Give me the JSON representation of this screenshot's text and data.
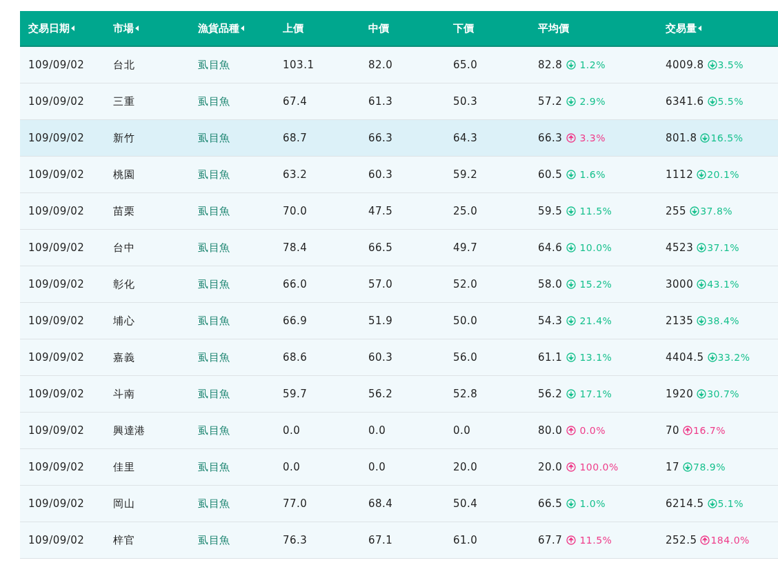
{
  "table": {
    "columns": [
      {
        "label": "交易日期",
        "sortable": true
      },
      {
        "label": "市場",
        "sortable": true
      },
      {
        "label": "漁貨品種",
        "sortable": true
      },
      {
        "label": "上價",
        "sortable": false
      },
      {
        "label": "中價",
        "sortable": false
      },
      {
        "label": "下價",
        "sortable": false
      },
      {
        "label": "平均價",
        "sortable": false
      },
      {
        "label": "交易量",
        "sortable": true
      }
    ],
    "rows": [
      {
        "selected": false,
        "date": "109/09/02",
        "market": "台北",
        "species": "虱目魚",
        "high": "103.1",
        "mid": "82.0",
        "low": "65.0",
        "avg": "82.8",
        "avg_change": {
          "kind": "down",
          "text": "1.2%"
        },
        "volume": "4009.8",
        "volume_change": {
          "kind": "down",
          "text": "3.5%"
        }
      },
      {
        "selected": false,
        "date": "109/09/02",
        "market": "三重",
        "species": "虱目魚",
        "high": "67.4",
        "mid": "61.3",
        "low": "50.3",
        "avg": "57.2",
        "avg_change": {
          "kind": "down",
          "text": "2.9%"
        },
        "volume": "6341.6",
        "volume_change": {
          "kind": "down",
          "text": "5.5%"
        }
      },
      {
        "selected": true,
        "date": "109/09/02",
        "market": "新竹",
        "species": "虱目魚",
        "high": "68.7",
        "mid": "66.3",
        "low": "64.3",
        "avg": "66.3",
        "avg_change": {
          "kind": "up",
          "text": "3.3%"
        },
        "volume": "801.8",
        "volume_change": {
          "kind": "down",
          "text": "16.5%"
        }
      },
      {
        "selected": false,
        "date": "109/09/02",
        "market": "桃園",
        "species": "虱目魚",
        "high": "63.2",
        "mid": "60.3",
        "low": "59.2",
        "avg": "60.5",
        "avg_change": {
          "kind": "down",
          "text": "1.6%"
        },
        "volume": "1112",
        "volume_change": {
          "kind": "down",
          "text": "20.1%"
        }
      },
      {
        "selected": false,
        "date": "109/09/02",
        "market": "苗栗",
        "species": "虱目魚",
        "high": "70.0",
        "mid": "47.5",
        "low": "25.0",
        "avg": "59.5",
        "avg_change": {
          "kind": "down",
          "text": "11.5%"
        },
        "volume": "255",
        "volume_change": {
          "kind": "down",
          "text": "37.8%"
        }
      },
      {
        "selected": false,
        "date": "109/09/02",
        "market": "台中",
        "species": "虱目魚",
        "high": "78.4",
        "mid": "66.5",
        "low": "49.7",
        "avg": "64.6",
        "avg_change": {
          "kind": "down",
          "text": "10.0%"
        },
        "volume": "4523",
        "volume_change": {
          "kind": "down",
          "text": "37.1%"
        }
      },
      {
        "selected": false,
        "date": "109/09/02",
        "market": "彰化",
        "species": "虱目魚",
        "high": "66.0",
        "mid": "57.0",
        "low": "52.0",
        "avg": "58.0",
        "avg_change": {
          "kind": "down",
          "text": "15.2%"
        },
        "volume": "3000",
        "volume_change": {
          "kind": "down",
          "text": "43.1%"
        }
      },
      {
        "selected": false,
        "date": "109/09/02",
        "market": "埔心",
        "species": "虱目魚",
        "high": "66.9",
        "mid": "51.9",
        "low": "50.0",
        "avg": "54.3",
        "avg_change": {
          "kind": "down",
          "text": "21.4%"
        },
        "volume": "2135",
        "volume_change": {
          "kind": "down",
          "text": "38.4%"
        }
      },
      {
        "selected": false,
        "date": "109/09/02",
        "market": "嘉義",
        "species": "虱目魚",
        "high": "68.6",
        "mid": "60.3",
        "low": "56.0",
        "avg": "61.1",
        "avg_change": {
          "kind": "down",
          "text": "13.1%"
        },
        "volume": "4404.5",
        "volume_change": {
          "kind": "down",
          "text": "33.2%"
        }
      },
      {
        "selected": false,
        "date": "109/09/02",
        "market": "斗南",
        "species": "虱目魚",
        "high": "59.7",
        "mid": "56.2",
        "low": "52.8",
        "avg": "56.2",
        "avg_change": {
          "kind": "down",
          "text": "17.1%"
        },
        "volume": "1920",
        "volume_change": {
          "kind": "down",
          "text": "30.7%"
        }
      },
      {
        "selected": false,
        "date": "109/09/02",
        "market": "興達港",
        "species": "虱目魚",
        "high": "0.0",
        "mid": "0.0",
        "low": "0.0",
        "avg": "80.0",
        "avg_change": {
          "kind": "up",
          "text": "0.0%"
        },
        "volume": "70",
        "volume_change": {
          "kind": "up",
          "text": "16.7%"
        }
      },
      {
        "selected": false,
        "date": "109/09/02",
        "market": "佳里",
        "species": "虱目魚",
        "high": "0.0",
        "mid": "0.0",
        "low": "20.0",
        "avg": "20.0",
        "avg_change": {
          "kind": "up",
          "text": "100.0%"
        },
        "volume": "17",
        "volume_change": {
          "kind": "down",
          "text": "78.9%"
        }
      },
      {
        "selected": false,
        "date": "109/09/02",
        "market": "岡山",
        "species": "虱目魚",
        "high": "77.0",
        "mid": "68.4",
        "low": "50.4",
        "avg": "66.5",
        "avg_change": {
          "kind": "down",
          "text": "1.0%"
        },
        "volume": "6214.5",
        "volume_change": {
          "kind": "down",
          "text": "5.1%"
        }
      },
      {
        "selected": false,
        "date": "109/09/02",
        "market": "梓官",
        "species": "虱目魚",
        "high": "76.3",
        "mid": "67.1",
        "low": "61.0",
        "avg": "67.7",
        "avg_change": {
          "kind": "up",
          "text": "11.5%"
        },
        "volume": "252.5",
        "volume_change": {
          "kind": "up",
          "text": "184.0%"
        }
      }
    ]
  }
}
